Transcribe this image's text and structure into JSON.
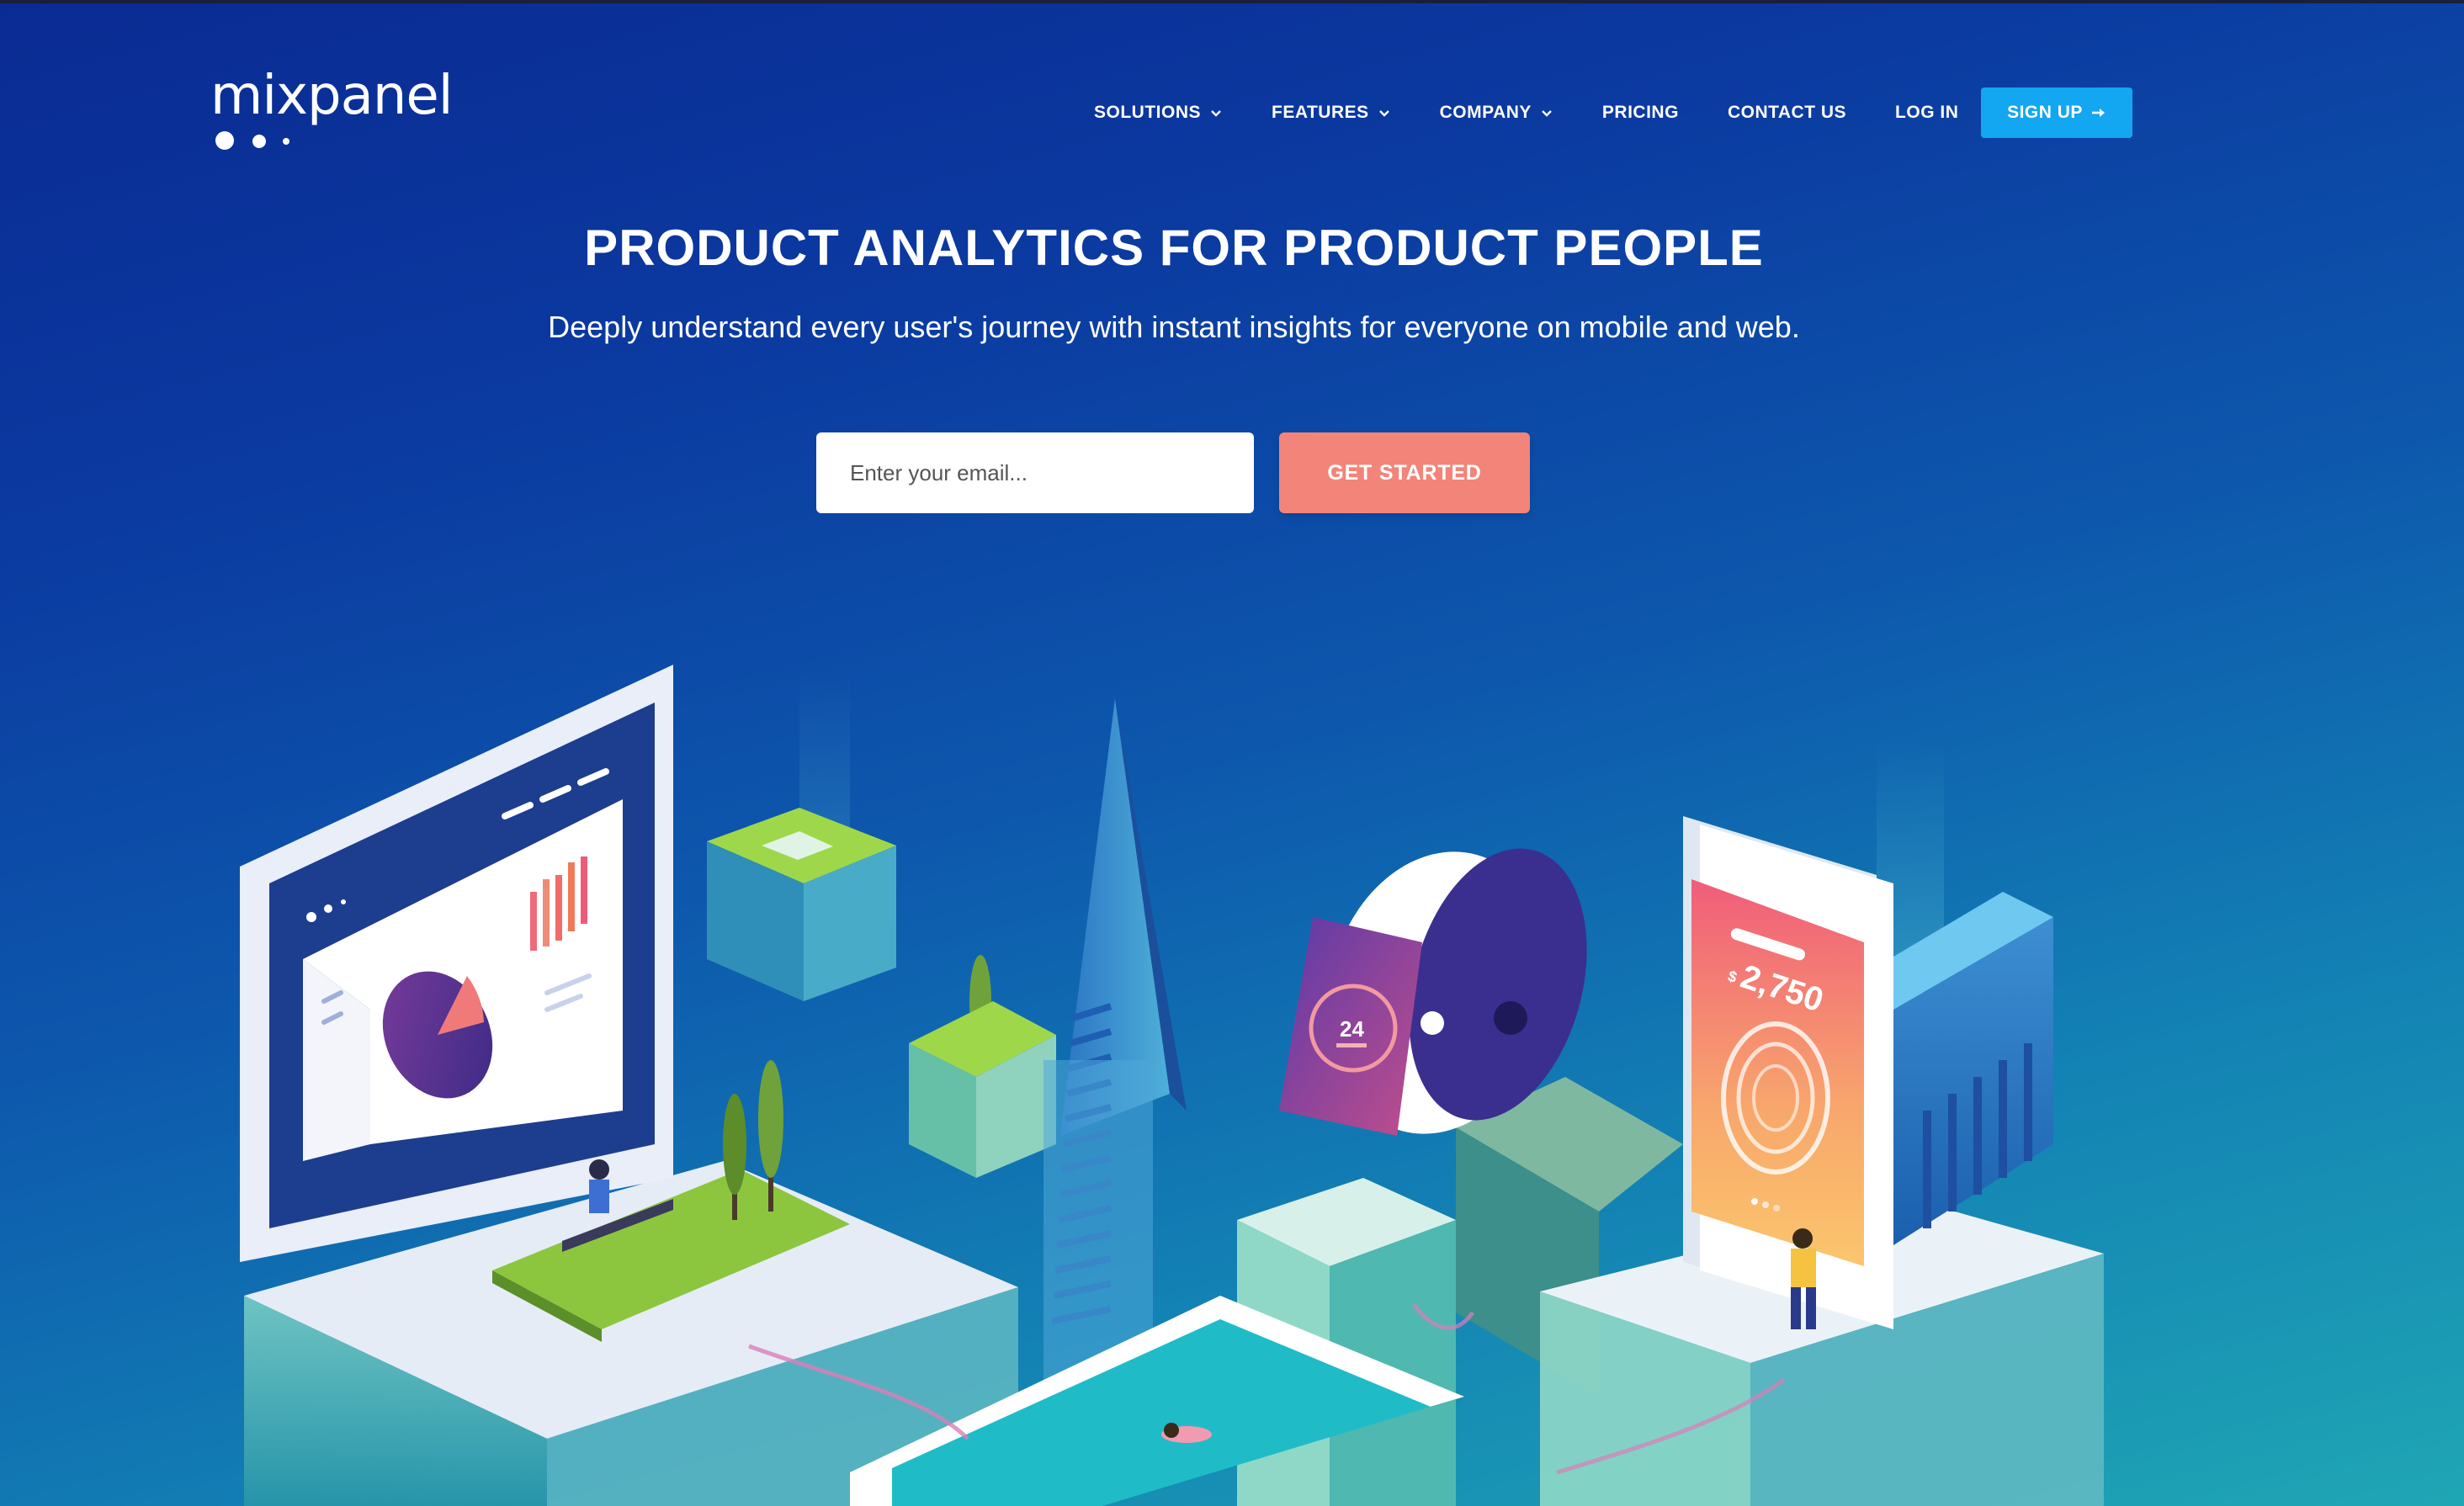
{
  "brand": {
    "logo_text": "mixpanel"
  },
  "nav": {
    "items": [
      {
        "label": "SOLUTIONS",
        "has_dropdown": true
      },
      {
        "label": "FEATURES",
        "has_dropdown": true
      },
      {
        "label": "COMPANY",
        "has_dropdown": true
      },
      {
        "label": "PRICING",
        "has_dropdown": false
      },
      {
        "label": "CONTACT US",
        "has_dropdown": false
      },
      {
        "label": "LOG IN",
        "has_dropdown": false
      }
    ],
    "signup_label": "SIGN UP"
  },
  "hero": {
    "title": "PRODUCT ANALYTICS FOR PRODUCT PEOPLE",
    "subtitle": "Deeply understand every user's journey with instant insights for everyone on mobile and web.",
    "email_placeholder": "Enter your email...",
    "email_value": "",
    "cta_label": "GET STARTED"
  },
  "illustration": {
    "watch_value": "24",
    "phone_currency": "$",
    "phone_amount": "2,750"
  },
  "colors": {
    "signup": "#12a7f0",
    "cta": "#f38479",
    "background_top": "#0a2b93",
    "background_bottom": "#1fa6b4"
  }
}
